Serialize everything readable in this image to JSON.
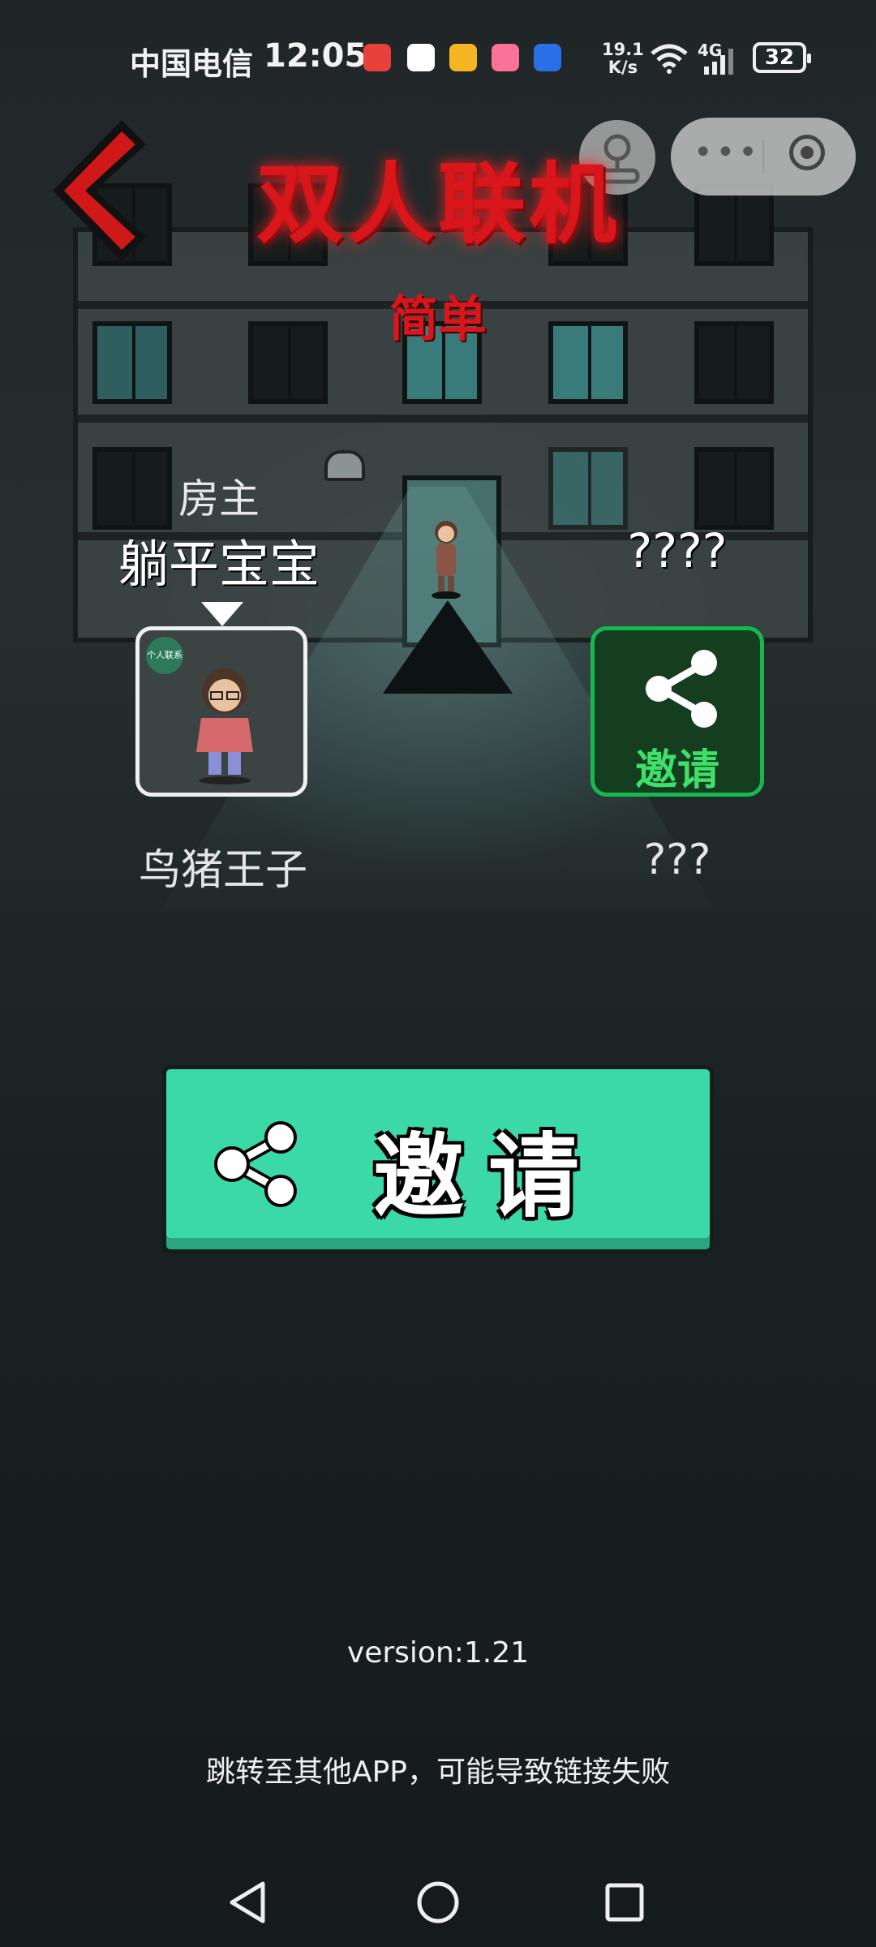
{
  "status_bar": {
    "carrier": "中国电信",
    "time": "12:05",
    "net_speed_value": "19.1",
    "net_speed_unit": "K/s",
    "network_type": "4G",
    "battery": "32",
    "app_icons": [
      {
        "name": "huawei-icon",
        "color": "#e8413c"
      },
      {
        "name": "qq-icon",
        "color": "#ffffff"
      },
      {
        "name": "mail-icon",
        "color": "#f6b624"
      },
      {
        "name": "bilibili-icon",
        "color": "#fb7299"
      },
      {
        "name": "bulb-icon",
        "color": "#2a6fe8"
      }
    ]
  },
  "header": {
    "title": "双人联机",
    "difficulty": "简单"
  },
  "host": {
    "role_label": "房主",
    "nickname": "躺平宝宝",
    "character_name": "鸟猪王子",
    "badge": "个人联系"
  },
  "guest": {
    "nickname": "????",
    "slot_label": "邀请",
    "character_name": "???"
  },
  "invite_button": {
    "label": "邀请"
  },
  "footer": {
    "version": "version:1.21",
    "hint": "跳转至其他APP，可能导致链接失败"
  },
  "colors": {
    "title_red": "#d8161b",
    "invite_green": "#3bd9a8",
    "slot_green": "#18b850"
  }
}
